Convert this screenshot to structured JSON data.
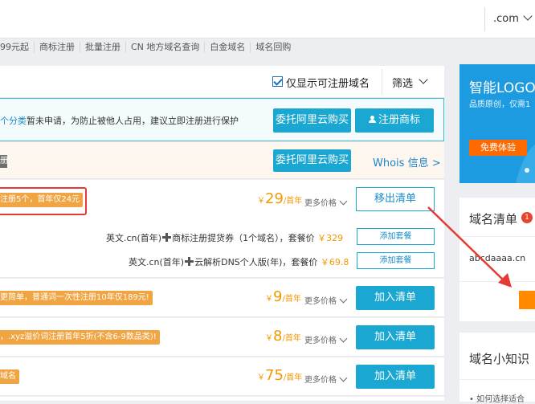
{
  "search": {
    "tld": ".com"
  },
  "quick_links": [
    "99元起",
    "商标注册",
    "批量注册",
    "CN 地方域名查询",
    "白金域名",
    "域名回购"
  ],
  "filter": {
    "only_available_label": "仅显示可注册域名",
    "sort_label": "筛选"
  },
  "notice": {
    "highlight": "个分类",
    "text": "暂未申请，为防止被他人占用，建议立即注册进行保护",
    "btn_entrust": "委托阿里云购买",
    "btn_trademark": "注册商标"
  },
  "registered_row": {
    "tag": "册",
    "btn_entrust": "委托阿里云购买",
    "whois": "Whois 信息 >"
  },
  "rows": [
    {
      "promo": "注册5个，首年仅24元",
      "price": "29",
      "unit": "/首年",
      "more": "更多价格",
      "action": "移出清单"
    },
    {
      "promo": "更简单，普通词一次性注册10年仅189元!",
      "price": "9",
      "unit": "/首年",
      "more": "更多价格",
      "action": "加入清单"
    },
    {
      "promo": "，.xyz溢价词注册首年5折(不含6-9数品类)!",
      "price": "8",
      "unit": "/首年",
      "more": "更多价格",
      "action": "加入清单"
    },
    {
      "promo": "域名",
      "price": "75",
      "unit": "/首年",
      "more": "更多价格",
      "action": "加入清单"
    }
  ],
  "packages": [
    {
      "part1": "英文.cn(首年)",
      "part2": "商标注册提货券（1个域名），套餐价",
      "price": "￥329",
      "btn": "添加套餐"
    },
    {
      "part1": "英文.cn(首年)",
      "part2": "云解析DNS个人版(年)，套餐价",
      "price": "￥69.8",
      "btn": "添加套餐"
    }
  ],
  "currency": "￥",
  "sidebar": {
    "ad_title": "智能LOGO",
    "ad_sub": "品质原创，仅需1",
    "ad_btn": "免费体验",
    "cart_title": "域名清单",
    "cart_count": "1",
    "cart_domain": "abcdaaaa.cn",
    "knowledge_title": "域名小知识",
    "knowledge_item": "• 如何选择适合"
  },
  "colors": {
    "brand_blue": "#1aa7d1",
    "price_orange": "#f39800",
    "promo_orange": "#f0a542",
    "annotation_red": "#e53935"
  }
}
